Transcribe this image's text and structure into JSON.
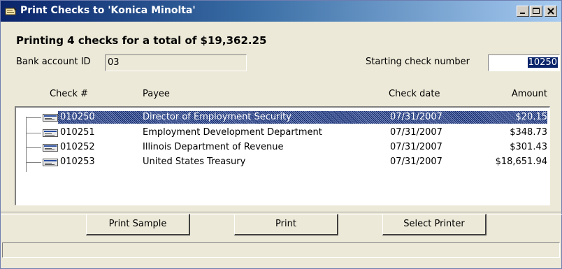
{
  "window": {
    "title": "Print Checks to 'Konica Minolta'"
  },
  "summary": "Printing 4 checks for a total of $19,362.25",
  "bank": {
    "label": "Bank account ID",
    "value": "03"
  },
  "start": {
    "label": "Starting check number",
    "value": "10250"
  },
  "columns": {
    "check": "Check #",
    "payee": "Payee",
    "date": "Check date",
    "amount": "Amount"
  },
  "checks": [
    {
      "num": "010250",
      "payee": "Director of Employment Security",
      "date": "07/31/2007",
      "amount": "$20.15",
      "selected": true
    },
    {
      "num": "010251",
      "payee": "Employment Development Department",
      "date": "07/31/2007",
      "amount": "$348.73",
      "selected": false
    },
    {
      "num": "010252",
      "payee": "Illinois Department of Revenue",
      "date": "07/31/2007",
      "amount": "$301.43",
      "selected": false
    },
    {
      "num": "010253",
      "payee": "United States Treasury",
      "date": "07/31/2007",
      "amount": "$18,651.94",
      "selected": false
    }
  ],
  "buttons": {
    "sample": "Print Sample",
    "print": "Print",
    "printer": "Select Printer"
  },
  "icons": {
    "app": "printer-checks-icon",
    "row": "check-icon"
  },
  "colors": {
    "selection": "#0a246a",
    "titlebar": "#0a246a"
  }
}
